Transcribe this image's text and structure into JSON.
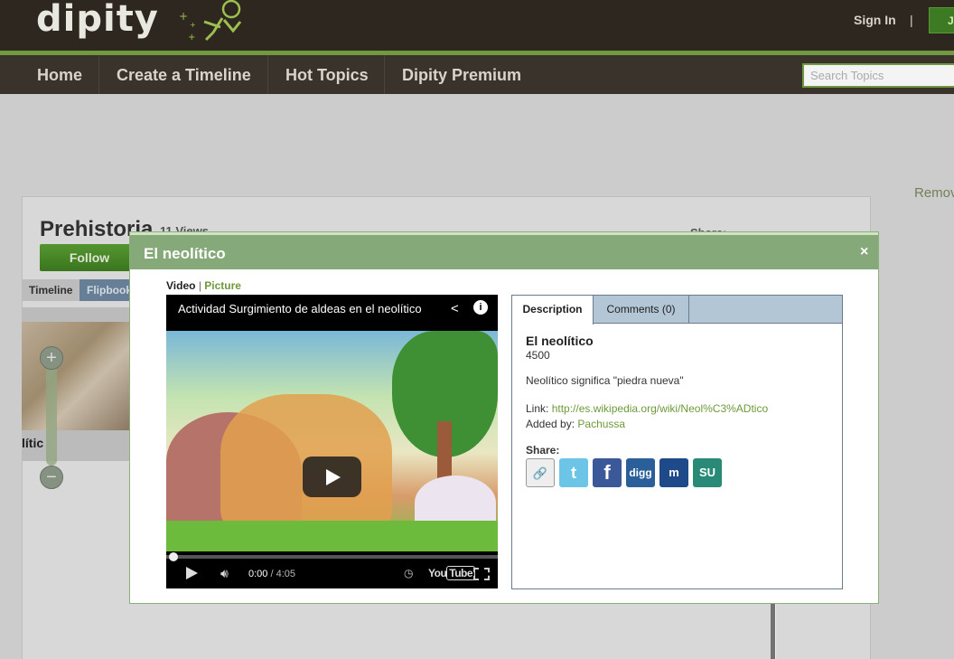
{
  "header": {
    "logo": "dipity",
    "sign_in": "Sign In",
    "separator": "|",
    "join_label": "J"
  },
  "nav": {
    "items": [
      "Home",
      "Create a Timeline",
      "Hot Topics",
      "Dipity Premium"
    ],
    "search_placeholder": "Search Topics"
  },
  "background_page": {
    "remove_label": "Remov",
    "title": "Prehistoria",
    "views": "11 Views",
    "share_label": "Share:",
    "follow_label": "Follow",
    "tabs": [
      "Timeline",
      "Flipbook"
    ],
    "timeline_snippet": "lític",
    "zoom_in": "+",
    "zoom_out": "−"
  },
  "modal": {
    "title": "El neolítico",
    "close": "×",
    "media_tabs": {
      "video": "Video",
      "separator": "|",
      "picture": "Picture"
    },
    "video": {
      "title": "Actividad Surgimiento de aldeas en el neolítico",
      "time_current": "0:00",
      "time_separator": " / ",
      "time_total": "4:05",
      "youtube": "You",
      "youtube_box": "Tube",
      "progress": 0.0
    },
    "description": {
      "tabs": [
        "Description",
        "Comments (0)"
      ],
      "event_title": "El neolítico",
      "year": "4500",
      "text": "Neolítico significa \"piedra nueva\"",
      "link_label": "Link:",
      "link_url": "http://es.wikipedia.org/wiki/Neol%C3%ADtico",
      "added_label": "Added by:",
      "added_by": "Pachussa",
      "share_label": "Share:",
      "share_buttons": [
        {
          "name": "link-icon",
          "glyph": "🔗",
          "color": "#eeeeee"
        },
        {
          "name": "twitter-icon",
          "glyph": "t",
          "color": "#6cc4e6"
        },
        {
          "name": "facebook-icon",
          "glyph": "f",
          "color": "#3b5998"
        },
        {
          "name": "digg-icon",
          "glyph": "digg",
          "color": "#2b5f99"
        },
        {
          "name": "myspace-icon",
          "glyph": "m",
          "color": "#1f4a8a"
        },
        {
          "name": "stumbleupon-icon",
          "glyph": "SU",
          "color": "#2a8a78"
        }
      ]
    }
  },
  "colors": {
    "header_bg": "#2d2720",
    "accent_green": "#6f9a3f",
    "modal_header": "#86a97a",
    "tab_bar": "#b3c6d6"
  }
}
